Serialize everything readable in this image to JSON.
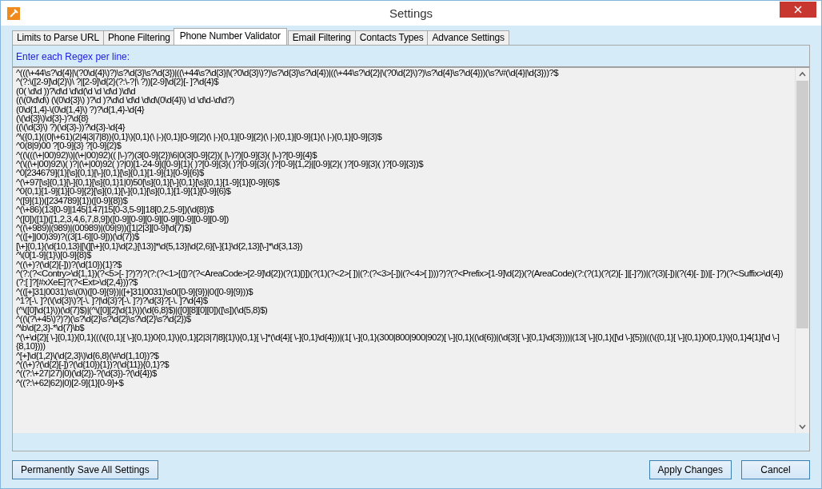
{
  "window": {
    "title": "Settings"
  },
  "tabs": [
    {
      "label": "Limits to Parse URL",
      "selected": false
    },
    {
      "label": "Phone Filtering",
      "selected": false
    },
    {
      "label": "Phone Number Validator",
      "selected": true
    },
    {
      "label": "Email Filtering",
      "selected": false
    },
    {
      "label": "Contacts Types",
      "selected": false
    },
    {
      "label": "Advance Settings",
      "selected": false
    }
  ],
  "instruction": "Enter each Regex per line:",
  "regex_lines": [
    "^(((\\+44\\s?\\d{4}|\\(?0\\d{4}\\)?)\\s?\\d{3}\\s?\\d{3})|((\\+44\\s?\\d{3}|\\(?0\\d{3}\\)?)\\s?\\d{3}\\s?\\d{4})|((\\+44\\s?\\d{2}|\\(?0\\d{2}\\)?)\\s?\\d{4}\\s?\\d{4}))(\\s?\\#(\\d{4}|\\d{3}))?$",
    "^(?:\\([2-9]\\d{2}\\)\\ ?|[2-9]\\d{2}(?:\\-?|\\ ?))[2-9]\\d{2}[- ]?\\d{4}$",
    "(0( \\d\\d ))?\\d\\d \\d\\d(\\d \\d \\d\\d )\\d\\d",
    "((\\(0\\d\\d\\) (\\(0\\d{3}\\) )?\\d )?\\d\\d \\d\\d \\d\\d\\(0\\d{4}\\) \\d \\d\\d-\\d\\d?)",
    "(0\\d{1,4}-\\(0\\d{1,4}\\) ?)?\\d{1,4}-\\d{4}",
    "(\\(\\d{3}\\)\\d{3}-)?\\d{8}",
    "((\\(\\d{3}\\) ?)(\\d{3}-))?\\d{3}-\\d{4}",
    "^\\({0,1}((0|\\+61)(2|4|3|7|8)){0,1}\\){0,1}(\\ |-){0,1}[0-9]{2}(\\ |-){0,1}[0-9]{2}(\\ |-){0,1}[0-9]{1}(\\ |-){0,1}[0-9]{3}$",
    "^0(8|9)00 ?[0-9]{3} ?[0-9]{2}$",
    "^((\\(((\\+|00)92)\\)|(\\+|00)92)(( |\\-)?)(3[0-9]{2})\\6|0(3[0-9]{2})( |\\-)?)[0-9]{3}( |\\-)?[0-9]{4}$",
    "^(\\((\\+|00)92\\)( )?|(\\+|00)92( )?|0)[1-24-9]([0-9]{1}( )?[0-9]{3}( )?[0-9]{3}( )?[0-9]{1,2}|[0-9]{2}( )?[0-9]{3}( )?[0-9]{3})$",
    "^0[234679]{1}[\\s]{0,1}[\\-]{0,1}[\\s]{0,1}[1-9]{1}[0-9]{6}$",
    "^(\\+97[\\s]{0,1}[\\-]{0,1}[\\s]{0,1}1|0)50[\\s]{0,1}[\\-]{0,1}[\\s]{0,1}[1-9]{1}[0-9]{6}$",
    "^0{0,1}[1-9]{1}[0-9]{2}[\\s]{0,1}[\\-]{0,1}[\\s]{0,1}[1-9]{1}[0-9]{6}$",
    "^([9]{1})([234789]{1})([0-9]{8})$",
    "^(\\+86)(13[0-9]|145|147|15[0-3,5-9]|18[0,2,5-9])(\\d{8})$",
    "^([0])([1])([1,2,3,4,6,7,8,9])([0-9][0-9][0-9][0-9][0-9][0-9][0-9])",
    "^((\\+989)|(989)|(00989)|(09|9))([1|2|3][0-9]\\d{7}$)",
    "^(([+]|00)39)?((3[1-6][0-9]))(\\d{7})$",
    "[\\+]{0,1}(\\d{10,13}|[\\(][\\+]{0,1}\\d{2,}[\\13)]*\\d{5,13}|\\d{2,6}[\\-]{1}\\d{2,13}[\\-]*\\d{3,13})",
    "^\\(0[1-9]{1}\\)[0-9]{8}$",
    "^((\\+)?(\\d{2}[-]))?(\\d{10}){1}?$",
    "^(?:(?<Contry>\\d{1,1})(?<5>[- ]?)?)?(?:(?<1>[(])?(?<AreaCode>[2-9]\\d{2})(?(1)[)])(?(1)(?<2>[ ])|(?:(?<3>[-])|(?<4>[ ])))?)?(?<Prefix>[1-9]\\d{2})(?(AreaCode)(?:(?(1)(?(2)[- ]|[-]?))|(?(3)[-])|(?(4)[- ]))|[- ]?)(?<Suffix>\\d{4})(?:[ ]?[#xXeE]?(?<Ext>\\d{2,4}))?$",
    "^(([+]31|0031)\\s\\(0\\)([0-9]{9})|([+]31|0031)\\s0([0-9]{9})|0([0-9]{9}))$",
    "^1?[-\\. ]?(\\(\\d{3}\\)?[-\\. ]?|\\d{3}?[-\\. ]?)?\\d{3}?[-\\. ]?\\d{4}$",
    "(^\\([0]\\d{1}\\))(\\d{7}$)|(^\\([0][2]\\d{1}\\))(\\d{6,8}$)|([0][8][0][0])([\\s])(\\d{5,8}$)",
    "^((\\(?\\+45\\)?)?)(\\s?\\d{2}\\s?\\d{2}\\s?\\d{2}\\s?\\d{2})$",
    "^\\b\\d{2,3}-*\\d{7}\\b$",
    "^(\\+\\d{2}[ \\-]{0,1}){0,1}(((\\({0,1}[ \\-]{0,1})0{0,1}\\){0,1}[2|3|7|8]{1}\\){0,1}[ \\-]*(\\d{4}[ \\-]{0,1}\\d{4}))|(1[ \\-]{0,1}(300|800|900|902)[ \\-]{0,1}((\\d{6})|(\\d{3}[ \\-]{0,1}\\d{3})))|(13[ \\-]{0,1}([\\d \\-]{5})|((\\({0,1}[ \\-]{0,1})0{0,1}\\){0,1}4{1}[\\d \\-]{8,10})))",
    "^[+]\\d{1,2}\\(\\d{2,3}\\)\\d{6,8}(\\#\\d{1,10})?$",
    "^((\\+)?(\\d{2}[-])?(\\d{10}){1})?(\\d{11}){0,1}?$",
    "^((?:\\+27|27)|0)(\\d{2})-?(\\d{3})-?(\\d{4})$",
    "^((?:\\+62|62)|0)[2-9]{1}[0-9]+$"
  ],
  "buttons": [
    {
      "label": "Permanently Save All Settings",
      "kind": "left"
    },
    {
      "label": "Apply Changes",
      "kind": "right"
    },
    {
      "label": "Cancel",
      "kind": "right"
    }
  ]
}
